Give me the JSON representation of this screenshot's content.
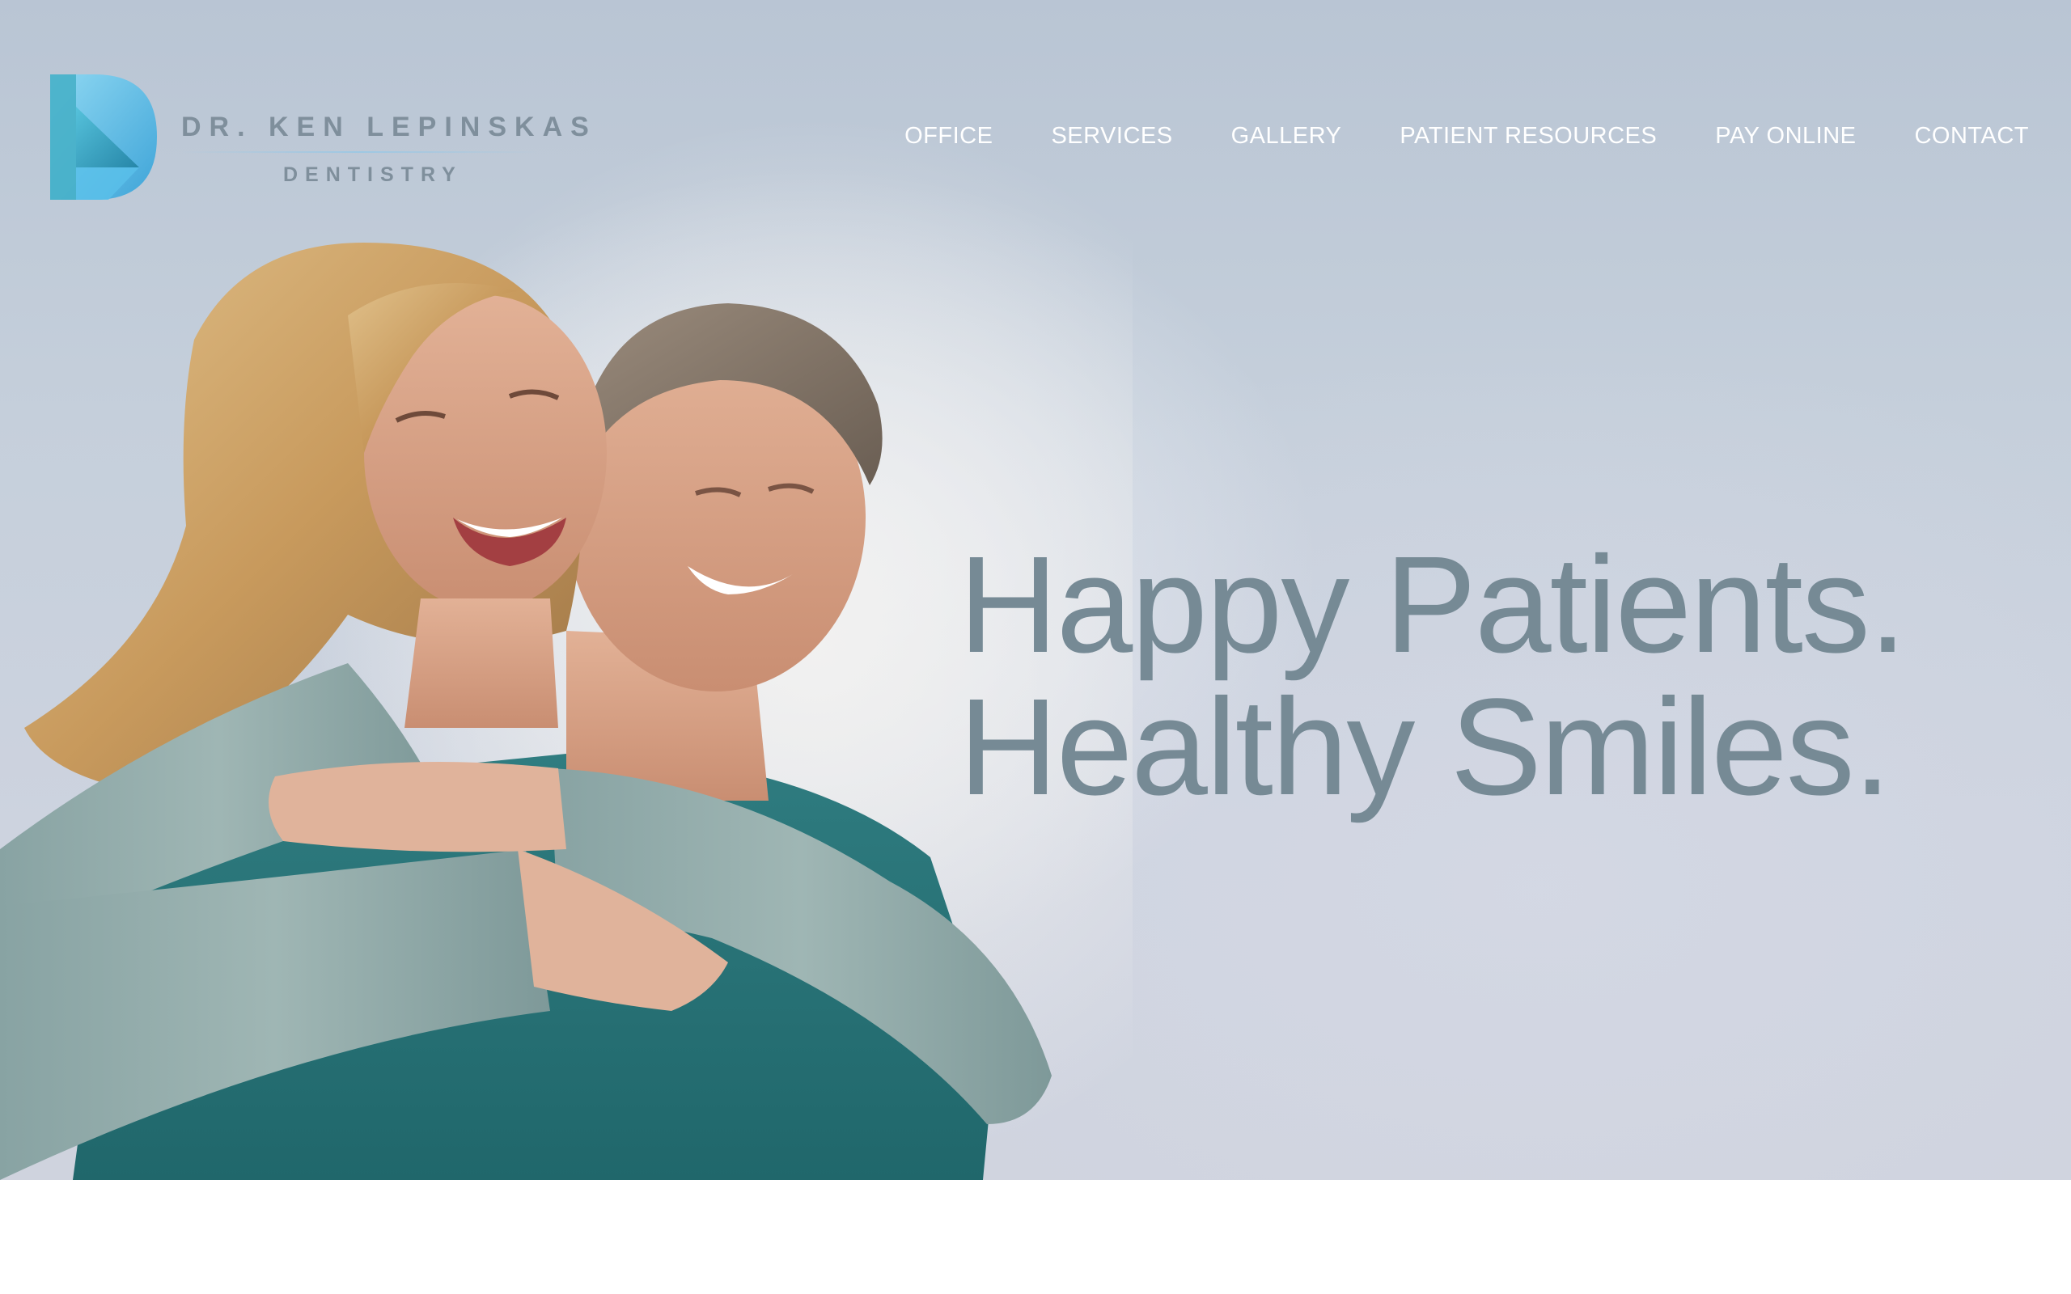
{
  "brand": {
    "name": "DR. KEN LEPINSKAS",
    "subtitle": "DENTISTRY",
    "logo_icon": "k-logo-icon"
  },
  "nav": {
    "items": [
      {
        "label": "OFFICE"
      },
      {
        "label": "SERVICES"
      },
      {
        "label": "GALLERY"
      },
      {
        "label": "PATIENT RESOURCES"
      },
      {
        "label": "PAY ONLINE"
      },
      {
        "label": "CONTACT"
      }
    ]
  },
  "hero": {
    "headline_line1": "Happy Patients.",
    "headline_line2": "Healthy Smiles.",
    "image_subject": "smiling couple hero photo"
  },
  "colors": {
    "headline": "#768a95",
    "nav_text": "#ffffff",
    "logo_text": "#7f8f9c",
    "logo_blue": "#4fb4e4",
    "sky": "#c5cfdb"
  }
}
